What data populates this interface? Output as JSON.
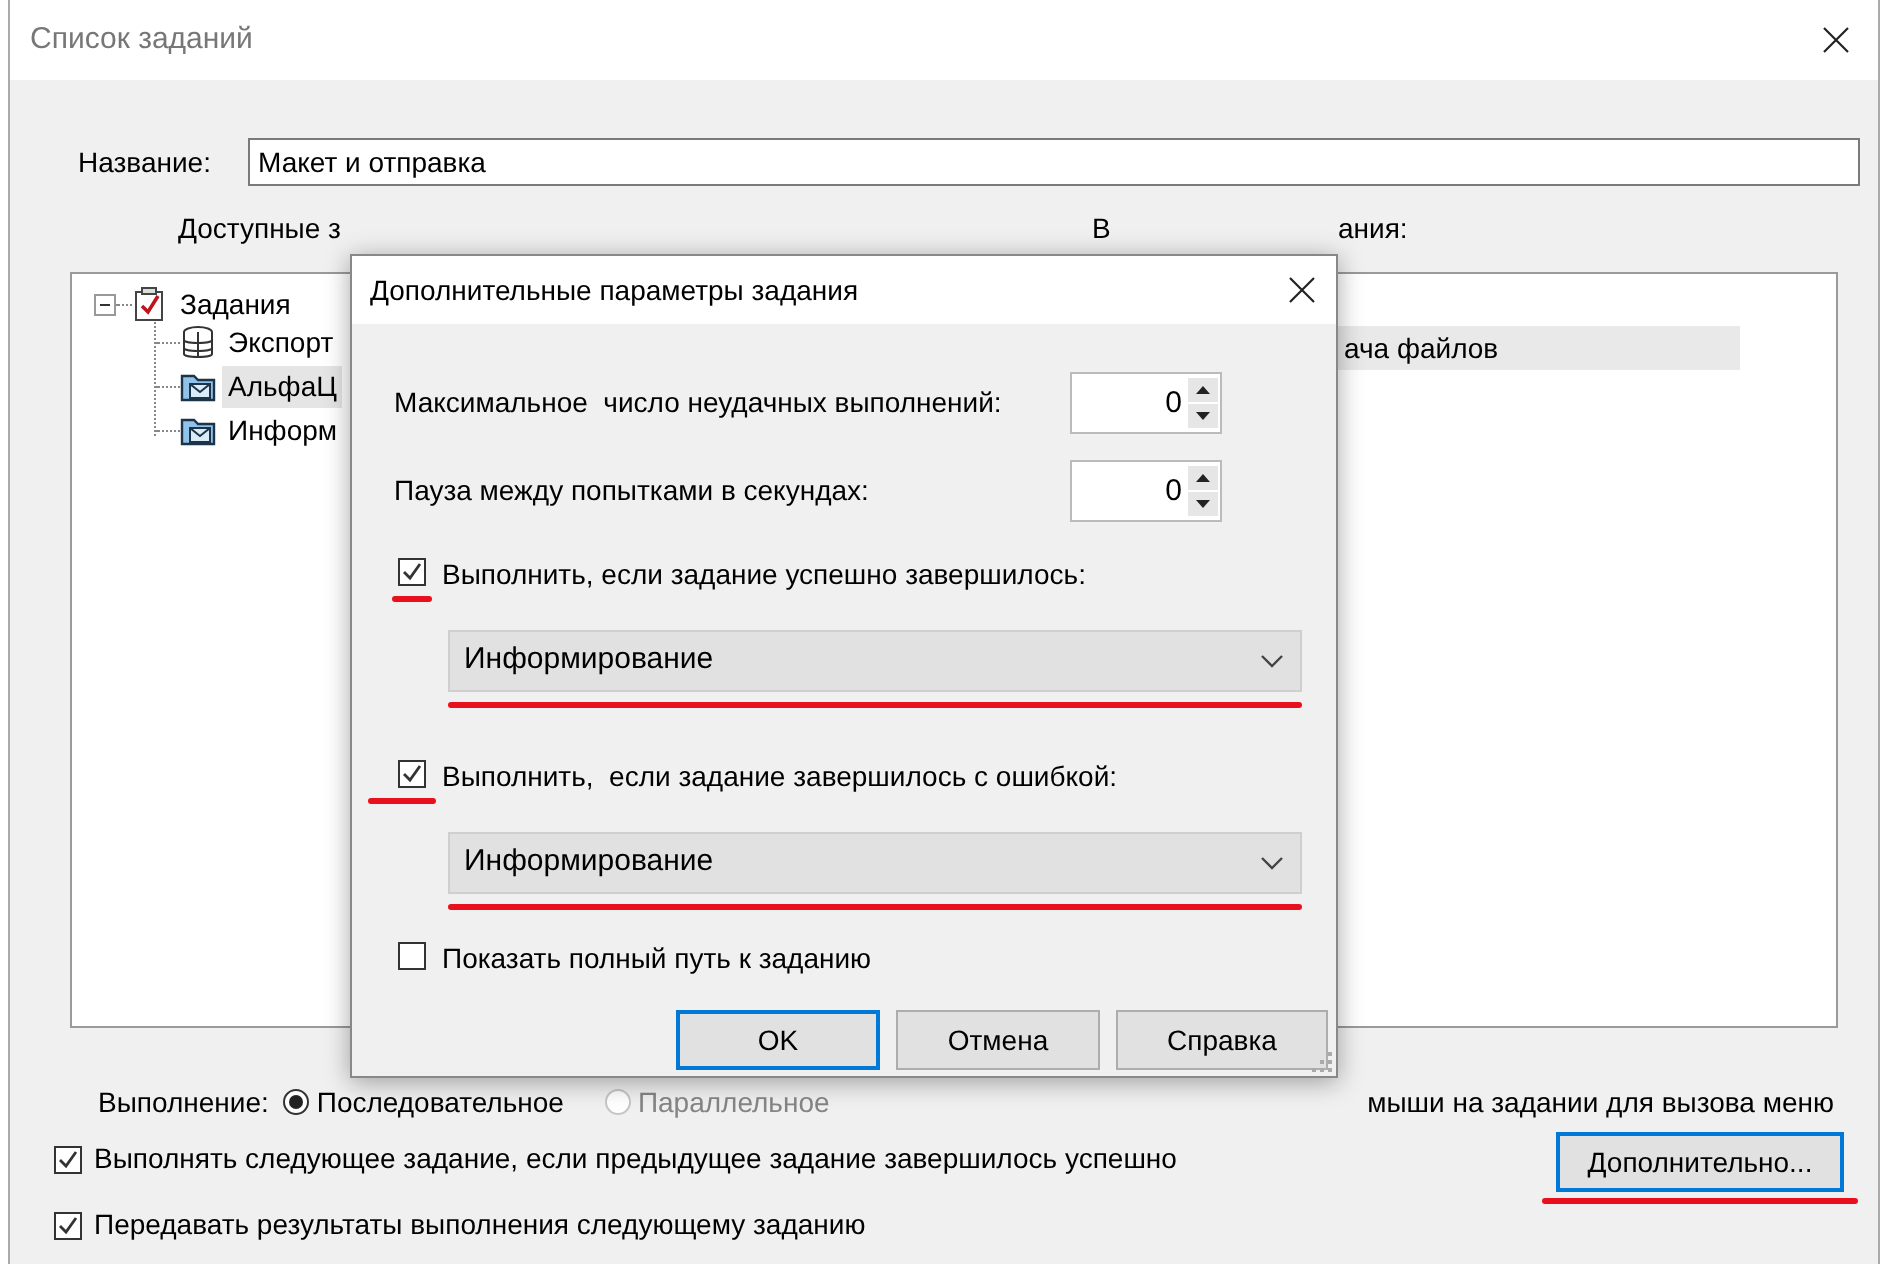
{
  "window": {
    "title": "Список заданий"
  },
  "name_field": {
    "label": "Название:",
    "value": "Макет и отправка"
  },
  "available_label": "Доступные з",
  "chosen_label": {
    "start": "В",
    "end": "ания:"
  },
  "tree": {
    "items": [
      {
        "label": "Задания",
        "kind": "task-list",
        "expanded": true,
        "selected": false,
        "children": [
          {
            "label": "Экспорт",
            "kind": "database",
            "selected": false
          },
          {
            "label": "АльфаЦ",
            "kind": "mail-folder",
            "selected": true
          },
          {
            "label": "Информ",
            "kind": "mail-folder",
            "selected": false
          }
        ]
      }
    ]
  },
  "chosen_list": {
    "items": [
      {
        "label": "ача файлов",
        "selected": true
      }
    ]
  },
  "execution": {
    "label": "Выполнение:",
    "options": [
      {
        "label": "Последовательное",
        "selected": true,
        "disabled": false
      },
      {
        "label": "Параллельное",
        "selected": false,
        "disabled": true
      }
    ]
  },
  "hint": "мыши на задании для вызова меню",
  "options": [
    {
      "label": "Выполнять следующее задание, если предыдущее задание завершилось успешно",
      "checked": true
    },
    {
      "label": "Передавать результаты выполнения следующему заданию",
      "checked": true
    }
  ],
  "more_button": {
    "label": "Дополнительно...",
    "default": true,
    "annotated": true
  },
  "dialog": {
    "title": "Дополнительные параметры задания",
    "rows": [
      {
        "kind": "spin",
        "label": "Максимальное  число неудачных выполнений:",
        "value": "0"
      },
      {
        "kind": "spin",
        "label": "Пауза между попытками в секундах:",
        "value": "0"
      },
      {
        "kind": "check",
        "label": "Выполнить, если задание успешно завершилось:",
        "checked": true,
        "annotated": true
      },
      {
        "kind": "select",
        "value": "Информирование",
        "annotated": true
      },
      {
        "kind": "check",
        "label": "Выполнить,  если задание завершилось с ошибкой:",
        "checked": true,
        "annotated": true
      },
      {
        "kind": "select",
        "value": "Информирование",
        "annotated": true
      },
      {
        "kind": "check",
        "label": "Показать полный путь к заданию",
        "checked": false,
        "annotated": false
      }
    ],
    "buttons": [
      {
        "label": "OK",
        "default": true
      },
      {
        "label": "Отмена",
        "default": false
      },
      {
        "label": "Справка",
        "default": false
      }
    ]
  }
}
